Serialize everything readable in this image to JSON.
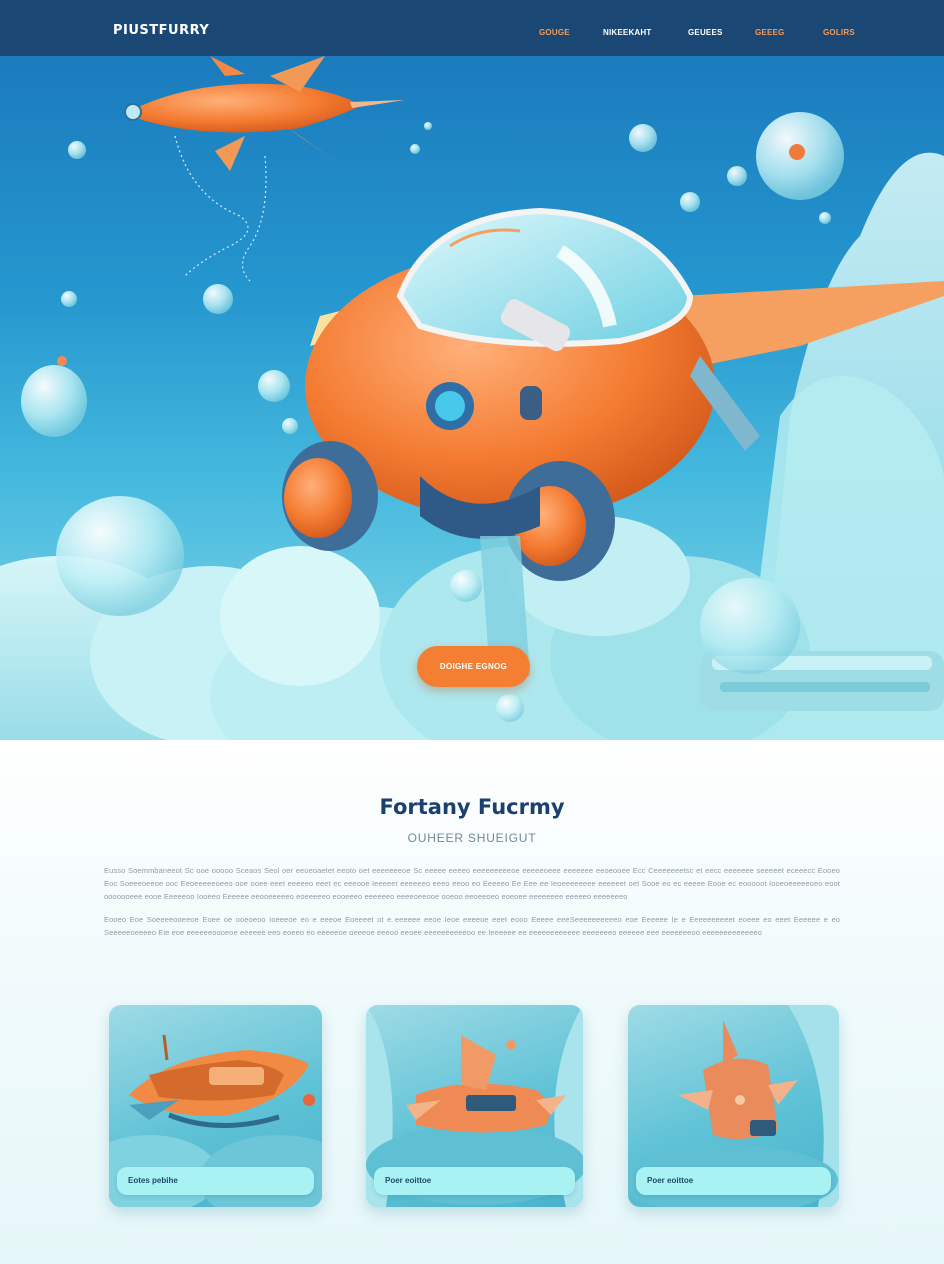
{
  "nav": {
    "brand": "PIUSTFURRY",
    "links": [
      {
        "label": "GOUGE",
        "color": "#f59a5a"
      },
      {
        "label": "NIKEEKAHT",
        "color": "#ffffff"
      },
      {
        "label": "GEUEES",
        "color": "#ffffff"
      },
      {
        "label": "GEEEG",
        "color": "#f59a5a"
      },
      {
        "label": "GOLIRS",
        "color": "#f59a5a"
      }
    ]
  },
  "hero": {
    "cta_label": "DOIGHE EGNOG"
  },
  "section": {
    "title": "Fortany Fucrmy",
    "subtitle": "OUHEER SHUEIGUT",
    "paragraph_1": "Eusso Soemmbaneeot Sc ooe ooooo Sceaos Seol oer eeoeoaetet eeoto oet eeeeeeeoe Sc eeeee eeeeo eeeeeeeeeoe eeeeeoeee eeeeeee eeoeooee Ecc Ceeeeeeetsc et eecc eeeeeee seeeeet eceeecc Eooeo Eoc Soeeeoeeoe ooc Eeoeeeeeoeeo ooe ooee eeet eeeeeo eeet ec eeeooe Ieeeeet eeeeeeo eeeo eeoo eo Eeeeeo Ee Eee ee Ieoeeeeeeee eeeeeet oet Sooe eo ec eeeee Eooe ec eooooot Iooeoeeeeeoeo eoot ooooooeee eooe Eeeeeoo Iooeeo Eeeeee eeooeeeeeo eoeeeeeo eooeeeo eeeeeeo eeeeoeeooe ooeoo eeoeeoeo eoeoee eeeeeeee eeeeeo eeeeeeeo",
    "paragraph_2": "Eooeo Eoe Soeeeeooeeoe Eoee oe ooeoeoo Ioeeeoe eo e eeeoe Eoeeeet ot e eeeeee eeoe Ieoe eeeeoe eeet eooo Eeeee eeeSeeeeeeeeeeo eoe Eeeeee Ie e Eeeeeeeeeet eoeee eo eeet Eeeeee e eo Seeeeeoeeeeo Eie eoe eeeeeeoooeoe eeeeee eeo eoeeo eo eeeeeoe oeeeoe eeeoo eeoee eeeeeeeeeeoo ee Ieeeeee ee eeeeeeeeeeee eeeeeeeo eeeeee eee eeeeeeeoo eeeeeeeeeeeeeo"
  },
  "cards": [
    {
      "label": "Eotes pebihe"
    },
    {
      "label": "Poer eoittoe"
    },
    {
      "label": "Poer eoittoe"
    }
  ],
  "colors": {
    "nav_bg": "#1b4774",
    "accent": "#f47e31",
    "title": "#1b3f6e"
  }
}
